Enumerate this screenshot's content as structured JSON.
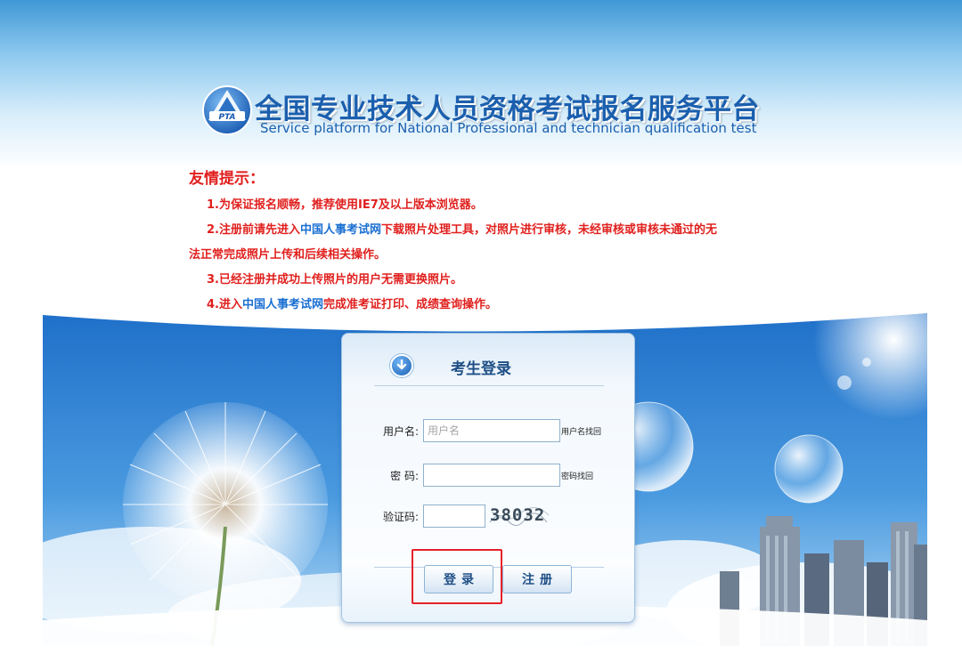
{
  "header": {
    "title_cn": "全国专业技术人员资格考试报名服务平台",
    "title_en": "Service platform for National Professional and technician qualification test",
    "logo_text": "PTA"
  },
  "tips": {
    "title": "友情提示：",
    "items": [
      {
        "prefix": "1.为保证报名顺畅，推荐使用IE7及以上版本浏览器。"
      },
      {
        "prefix": "2.注册前请先进入",
        "link": "中国人事考试网",
        "suffix": "下载照片处理工具，对照片进行审核，未经审核或审核未通过的无"
      },
      {
        "prefix": "法正常完成照片上传和后续相关操作。"
      },
      {
        "prefix": "3.已经注册并成功上传照片的用户无需更换照片。"
      },
      {
        "prefix": "4.进入",
        "link": "中国人事考试网",
        "suffix": "完成准考证打印、成绩查询操作。"
      }
    ]
  },
  "login": {
    "title": "考生登录",
    "username_label": "用户名:",
    "username_placeholder": "用户名",
    "username_recover": "用户名找回",
    "password_label": "密  码:",
    "password_recover": "密码找回",
    "captcha_label": "验证码:",
    "captcha_text": "38032",
    "login_button": "登录",
    "register_button": "注册"
  },
  "colors": {
    "tip_red": "#e0201e",
    "link_blue": "#1a6fd2",
    "brand_blue": "#1b5fae",
    "highlight_red": "#e5222b"
  }
}
